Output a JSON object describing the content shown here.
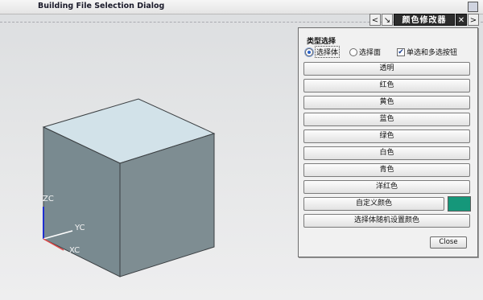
{
  "window": {
    "title": "Building File Selection Dialog"
  },
  "panel": {
    "header_title": "颜色修改器",
    "back_symbol": "<",
    "pin_symbol": "↘",
    "close_symbol": "✕",
    "next_symbol": ">",
    "section_title": "类型选择",
    "options": {
      "select_body": "选择体",
      "select_face": "选择面",
      "single_multi": "单选和多选按钮",
      "selected": "select_body",
      "single_multi_checked": true
    },
    "color_buttons": [
      {
        "label": "透明"
      },
      {
        "label": "红色"
      },
      {
        "label": "黄色"
      },
      {
        "label": "蓝色"
      },
      {
        "label": "绿色"
      },
      {
        "label": "白色"
      },
      {
        "label": "青色"
      },
      {
        "label": "洋红色"
      }
    ],
    "custom_color_label": "自定义颜色",
    "custom_swatch_color": "#15977a",
    "random_label": "选择体随机设置颜色",
    "close_label": "Close"
  },
  "viewport": {
    "cube_top_color": "#d2e2e9",
    "cube_left_color": "#798a90",
    "cube_right_color": "#7e8d92",
    "axis_labels": {
      "z": "ZC",
      "y": "YC",
      "x": "XC"
    },
    "axis_colors": {
      "z": "#1f2fd0",
      "y": "#ffffff",
      "x": "#e04848"
    }
  }
}
